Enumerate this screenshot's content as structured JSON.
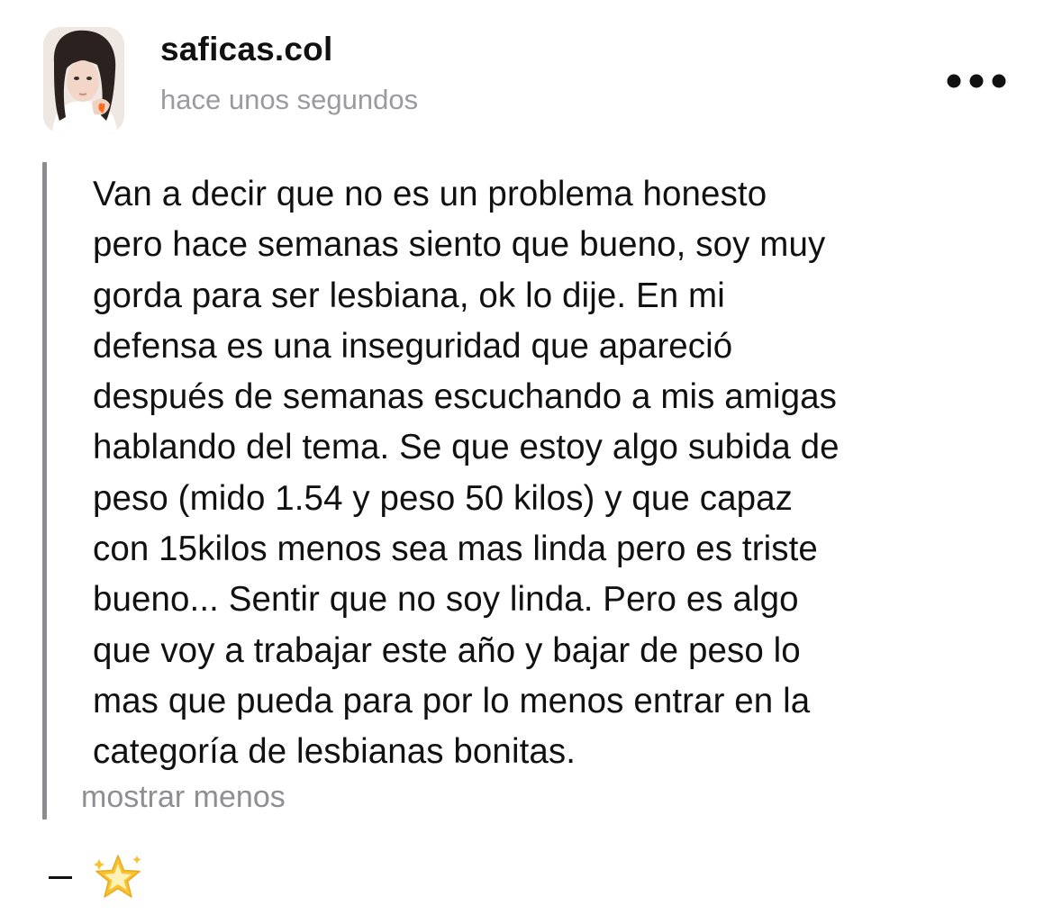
{
  "post": {
    "username": "saficas.col",
    "timestamp": "hace unos segundos",
    "body": "Van a decir que no es un problema honesto\npero hace semanas siento que bueno, soy muy\ngorda para ser lesbiana, ok lo dije. En mi\ndefensa es una inseguridad que apareció\ndespués de semanas escuchando a mis amigas\nhablando del tema. Se que estoy algo subida de\npeso (mido 1.54 y peso 50 kilos) y que capaz\ncon 15kilos menos sea mas linda pero es triste\nbueno... Sentir que no soy linda. Pero es algo\nque voy a trabajar este año y bajar de peso lo\nmas que pueda para por lo menos entrar en la\ncategoría de lesbianas bonitas.",
    "show_less_label": "mostrar menos",
    "more_icon": "more-horizontal-icon",
    "avatar_icon": "avatar-photo"
  },
  "footer": {
    "dash": "—",
    "star_icon": "glowing-star-icon"
  },
  "colors": {
    "text": "#111111",
    "secondary_text": "#9a9a9f",
    "quote_bar": "#8c8c90",
    "star": "#f7c42f"
  }
}
